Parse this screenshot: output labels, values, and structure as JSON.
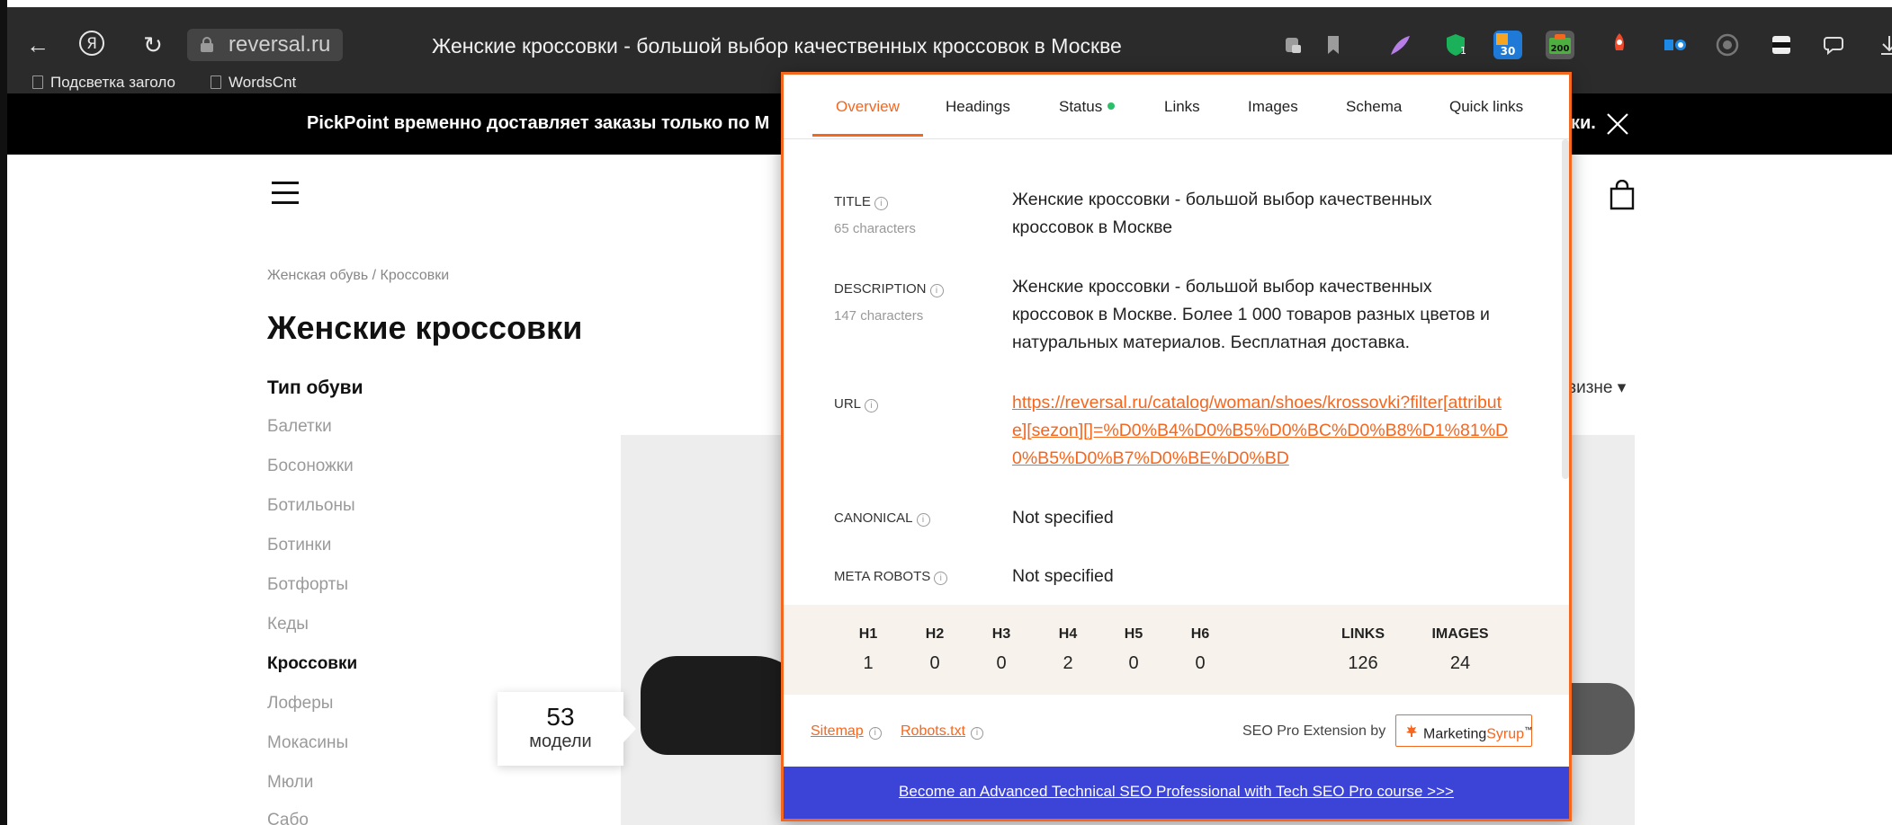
{
  "browser": {
    "address": "reversal.ru",
    "tab_title": "Женские кроссовки - большой выбор качественных кроссовок в Москве",
    "bookmarks": [
      "Подсветка заголо",
      "WordsCnt"
    ],
    "extensions": [
      {
        "icon": "badge-1-icon",
        "badge": ""
      },
      {
        "icon": "badge-30-icon",
        "badge": "30"
      },
      {
        "icon": "badge-200-icon",
        "badge": "200"
      }
    ]
  },
  "promo": {
    "left": "PickPoint временно доставляет заказы только по М",
    "right": "ки."
  },
  "site": {
    "breadcrumb": "Женская обувь / Кроссовки",
    "title": "Женские кроссовки",
    "category_heading": "Тип обуви",
    "categories": [
      "Балетки",
      "Босоножки",
      "Ботильоны",
      "Ботинки",
      "Ботфорты",
      "Кеды",
      "Кроссовки",
      "Лоферы",
      "Мокасины",
      "Мюли",
      "Сабо"
    ],
    "active_category": "Кроссовки",
    "sort_partial": "визне ▾",
    "model_count": "53",
    "model_label": "модели"
  },
  "popup": {
    "tabs": [
      "Overview",
      "Headings",
      "Status",
      "Links",
      "Images",
      "Schema",
      "Quick links"
    ],
    "active_tab": "Overview",
    "status_color": "#2cbf6a",
    "accent": "#f5661f",
    "rows": {
      "title_label": "TITLE",
      "title_count": "65 characters",
      "title_value": "Женские кроссовки - большой выбор качественных кроссовок в Москве",
      "description_label": "DESCRIPTION",
      "description_count": "147 characters",
      "description_value": "Женские кроссовки - большой выбор качественных кроссовок в Москве. Более 1 000 товаров разных цветов и натуральных материалов. Бесплатная доставка.",
      "url_label": "URL",
      "url_value": "https://reversal.ru/catalog/woman/shoes/krossovki?filter[attribute][sezon][]=%D0%B4%D0%B5%D0%BC%D0%B8%D1%81%D0%B5%D0%B7%D0%BE%D0%BD",
      "canonical_label": "CANONICAL",
      "canonical_value": "Not specified",
      "robots_label": "META ROBOTS",
      "robots_value": "Not specified"
    },
    "stats": {
      "headers": [
        "H1",
        "H2",
        "H3",
        "H4",
        "H5",
        "H6"
      ],
      "values": [
        "1",
        "0",
        "0",
        "2",
        "0",
        "0"
      ],
      "links_label": "LINKS",
      "links_value": "126",
      "images_label": "IMAGES",
      "images_value": "24"
    },
    "footer": {
      "sitemap": "Sitemap",
      "robots": "Robots.txt",
      "by": "SEO Pro Extension by",
      "brand_a": "Marketing",
      "brand_b": "Syrup",
      "tm": "™"
    },
    "banner": "Become an Advanced Technical SEO Professional with Tech SEO Pro course >>>",
    "banner_color": "#3c44d8"
  }
}
